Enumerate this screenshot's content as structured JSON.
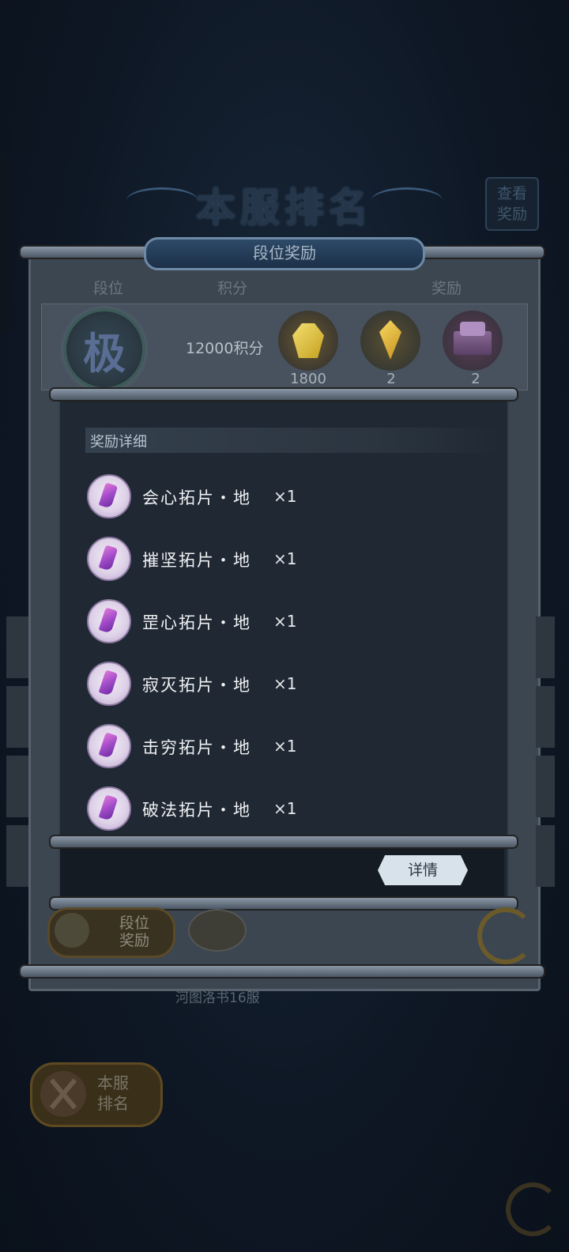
{
  "header": {
    "title": "本服排名",
    "view_reward_line1": "查看",
    "view_reward_line2": "奖励"
  },
  "panel": {
    "tab_title": "段位奖励",
    "columns": [
      "段位",
      "积分",
      "奖励"
    ],
    "rank_badge_char": "极",
    "score_text": "12000积分",
    "rewards": [
      {
        "icon": "gold-gem-icon",
        "count": "1800"
      },
      {
        "icon": "yellow-crystal-icon",
        "count": "2"
      },
      {
        "icon": "purple-chest-icon",
        "count": "2"
      }
    ]
  },
  "modal": {
    "title": "奖励详细",
    "items": [
      {
        "name": "会心拓片・地",
        "qty": "×1"
      },
      {
        "name": "摧坚拓片・地",
        "qty": "×1"
      },
      {
        "name": "罡心拓片・地",
        "qty": "×1"
      },
      {
        "name": "寂灭拓片・地",
        "qty": "×1"
      },
      {
        "name": "击穷拓片・地",
        "qty": "×1"
      },
      {
        "name": "破法拓片・地",
        "qty": "×1"
      }
    ],
    "detail_button": "详情"
  },
  "footer": {
    "rank_reward_line1": "段位",
    "rank_reward_line2": "奖励",
    "server_name": "河图洛书16服"
  },
  "bottom": {
    "server_rank_line1": "本服",
    "server_rank_line2": "排名"
  }
}
